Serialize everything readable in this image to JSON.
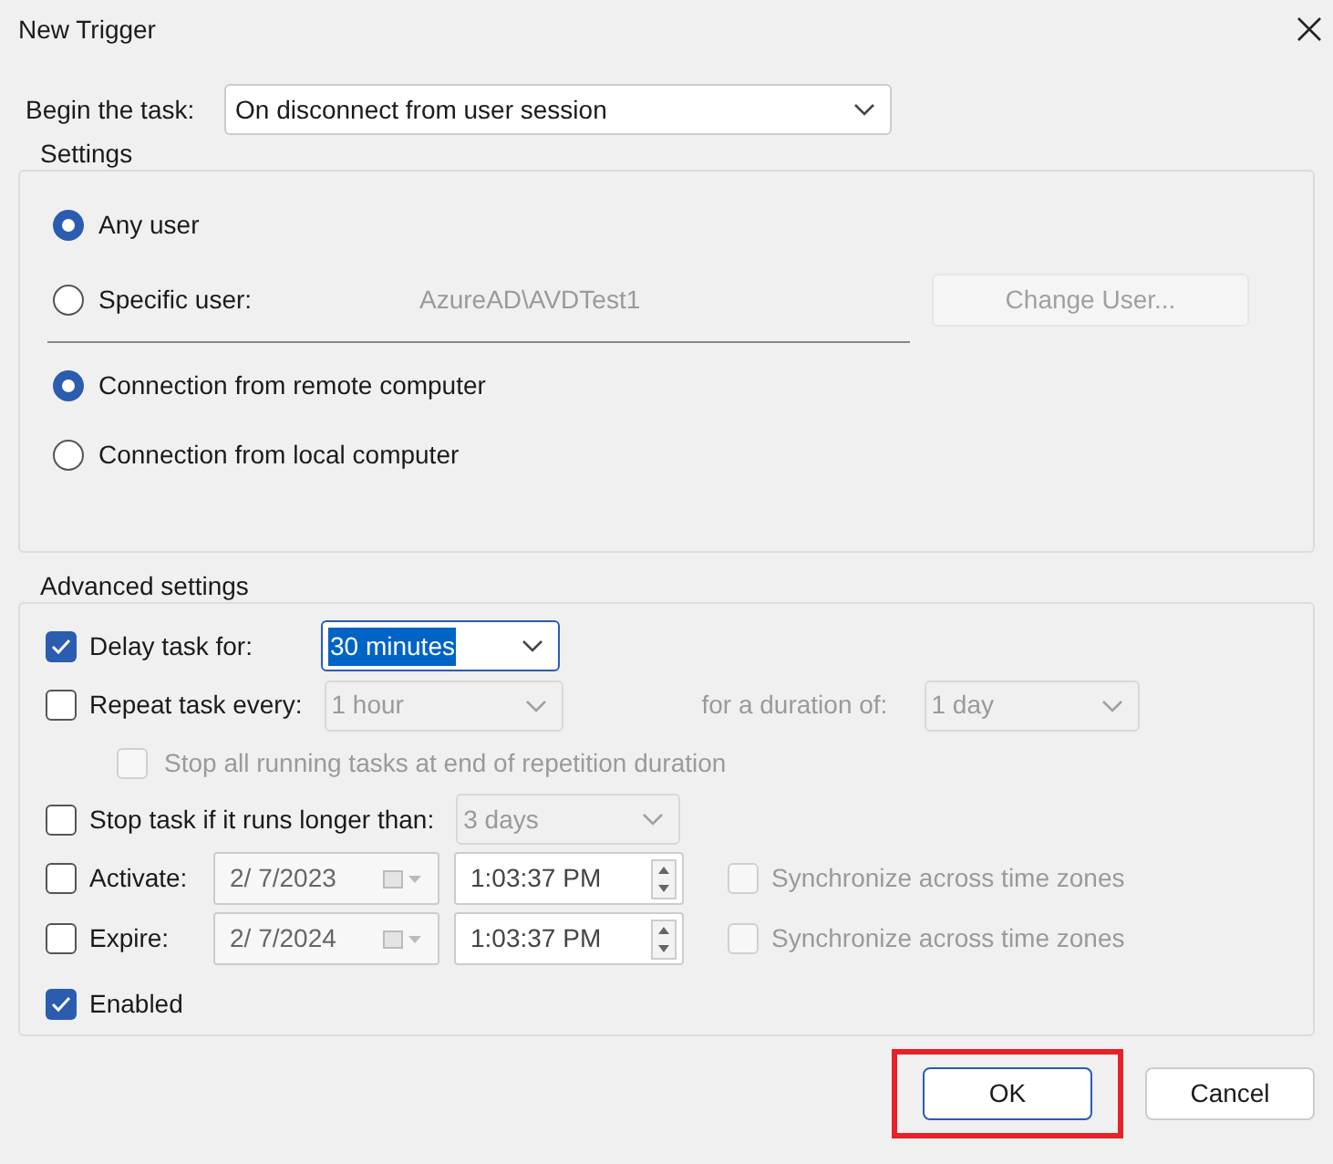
{
  "window": {
    "title": "New Trigger"
  },
  "begin_task": {
    "label": "Begin the task:",
    "value": "On disconnect from user session"
  },
  "settings": {
    "title": "Settings",
    "user_options": [
      {
        "label": "Any user",
        "selected": true
      },
      {
        "label": "Specific user:",
        "selected": false,
        "user": "AzureAD\\AVDTest1"
      }
    ],
    "change_user_button": {
      "label": "Change User...",
      "disabled": true
    },
    "connection_options": [
      {
        "label": "Connection from remote computer",
        "selected": true
      },
      {
        "label": "Connection from local computer",
        "selected": false
      }
    ]
  },
  "advanced": {
    "title": "Advanced settings",
    "rows": [
      {
        "kind": "combo",
        "label": "Delay task for:",
        "checked": true,
        "disabled": false,
        "combo": {
          "value": "30 minutes",
          "disabled": false,
          "highlighted": true
        }
      },
      {
        "kind": "combo",
        "label": "Repeat task every:",
        "checked": false,
        "disabled": false,
        "combo": {
          "value": "1 hour",
          "disabled": true,
          "highlighted": false
        },
        "duration": {
          "label": "for a duration of:",
          "value": "1 day",
          "disabled": true
        }
      },
      {
        "kind": "sub",
        "label": "Stop all running tasks at end of repetition duration",
        "checked": false,
        "disabled": true
      },
      {
        "kind": "combo",
        "label": "Stop task if it runs longer than:",
        "checked": false,
        "disabled": false,
        "combo": {
          "value": "3 days",
          "disabled": true,
          "highlighted": false
        }
      },
      {
        "kind": "datetime",
        "label": "Activate:",
        "checked": false,
        "disabled": false,
        "date": "2/  7/2023",
        "time": "1:03:37 PM",
        "sync": {
          "label": "Synchronize across time zones",
          "checked": false,
          "disabled": true
        }
      },
      {
        "kind": "datetime",
        "label": "Expire:",
        "checked": false,
        "disabled": false,
        "date": "2/  7/2024",
        "time": "1:03:37 PM",
        "sync": {
          "label": "Synchronize across time zones",
          "checked": false,
          "disabled": true
        }
      },
      {
        "kind": "plain",
        "label": "Enabled",
        "checked": true,
        "disabled": false
      }
    ]
  },
  "buttons": [
    {
      "label": "OK",
      "default": true,
      "highlighted": true
    },
    {
      "label": "Cancel",
      "default": false,
      "highlighted": false
    }
  ]
}
